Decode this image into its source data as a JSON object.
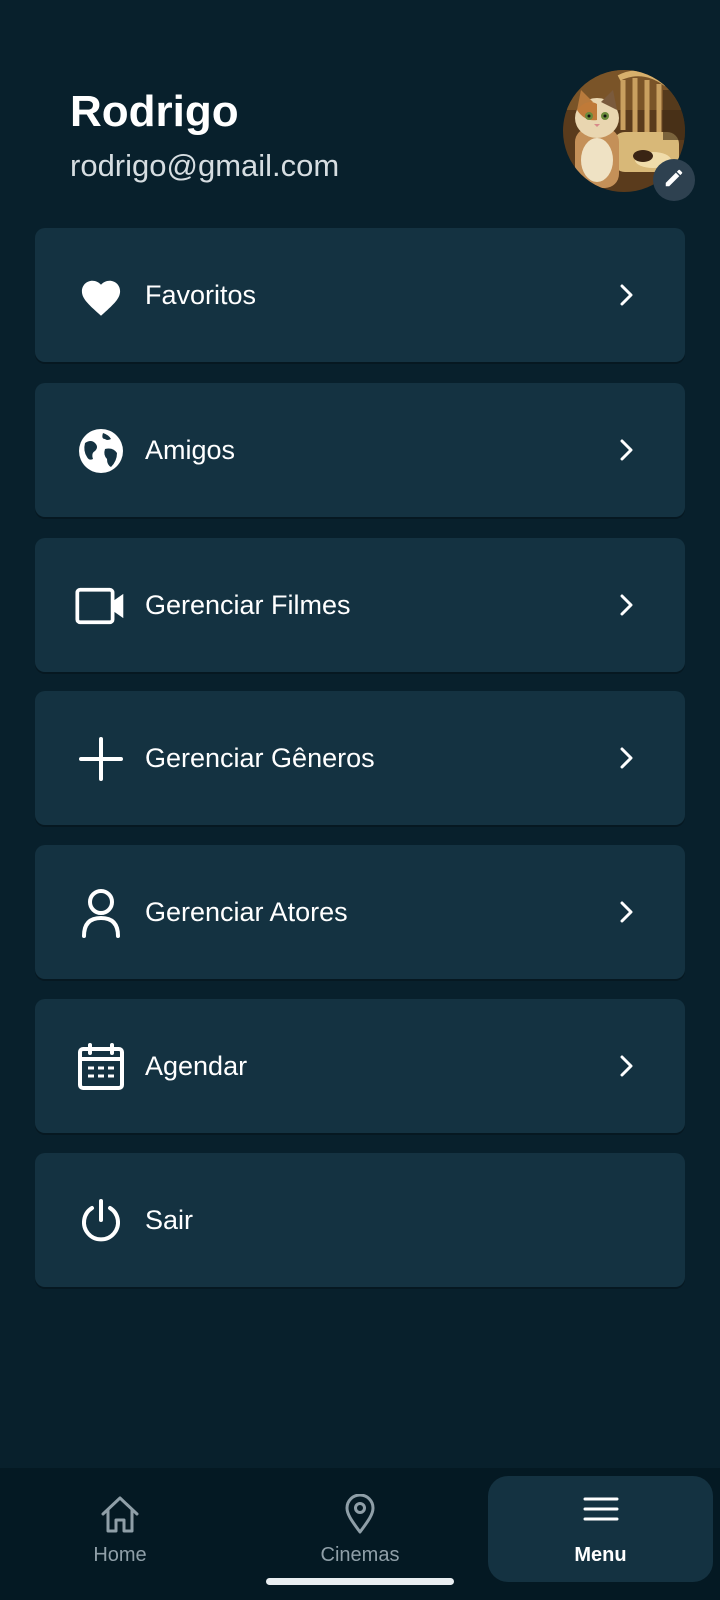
{
  "profile": {
    "name": "Rodrigo",
    "email": "rodrigo@gmail.com",
    "avatar_icon": "cat-photo-avatar",
    "edit_icon": "pencil-icon"
  },
  "menu": {
    "items": [
      {
        "label": "Favoritos",
        "icon": "heart-icon",
        "has_chevron": true
      },
      {
        "label": "Amigos",
        "icon": "globe-icon",
        "has_chevron": true
      },
      {
        "label": "Gerenciar Filmes",
        "icon": "video-camera-icon",
        "has_chevron": true
      },
      {
        "label": "Gerenciar Gêneros",
        "icon": "plus-icon",
        "has_chevron": true
      },
      {
        "label": "Gerenciar Atores",
        "icon": "person-icon",
        "has_chevron": true
      },
      {
        "label": "Agendar",
        "icon": "calendar-icon",
        "has_chevron": true
      },
      {
        "label": "Sair",
        "icon": "power-icon",
        "has_chevron": false
      }
    ]
  },
  "bottom_nav": {
    "items": [
      {
        "label": "Home",
        "icon": "home-icon",
        "active": false
      },
      {
        "label": "Cinemas",
        "icon": "map-pin-icon",
        "active": false
      },
      {
        "label": "Menu",
        "icon": "hamburger-menu-icon",
        "active": true
      }
    ]
  },
  "colors": {
    "background": "#08202c",
    "card": "#143241",
    "nav_background": "#041923",
    "text": "#ffffff",
    "muted_text": "#8f9fa8"
  }
}
